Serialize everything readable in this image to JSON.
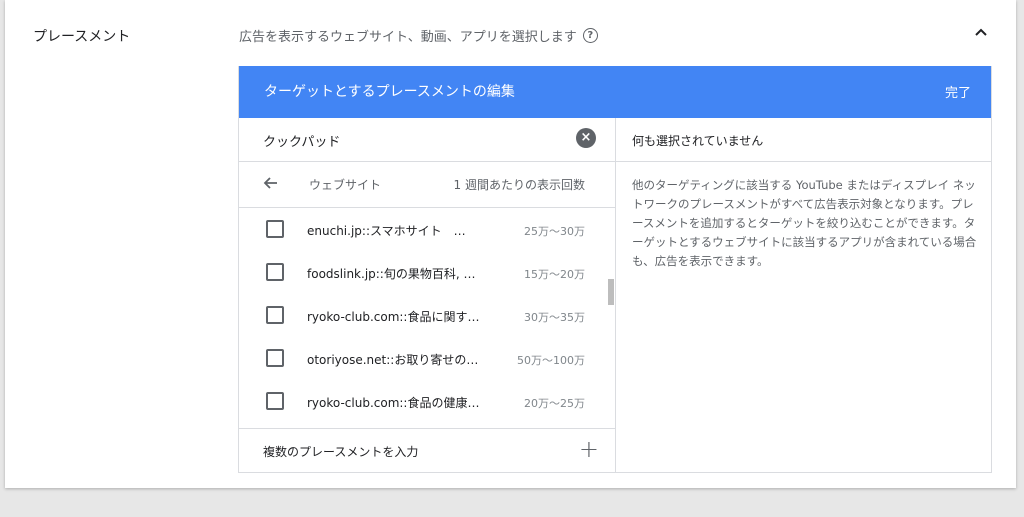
{
  "section": {
    "label": "プレースメント",
    "description": "広告を表示するウェブサイト、動画、アプリを選択します"
  },
  "editor": {
    "title": "ターゲットとするプレースメントの編集",
    "done_label": "完了",
    "search_value": "クックパッド",
    "nav": {
      "category": "ウェブサイト",
      "column_header": "1 週間あたりの表示回数"
    },
    "items": [
      {
        "name": "enuchi.jp::スマホサイト　…",
        "count": "25万～30万"
      },
      {
        "name": "foodslink.jp::旬の果物百科, …",
        "count": "15万～20万"
      },
      {
        "name": "ryoko-club.com::食品に関す…",
        "count": "30万～35万"
      },
      {
        "name": "otoriyose.net::お取り寄せの…",
        "count": "50万～100万"
      },
      {
        "name": "ryoko-club.com::食品の健康…",
        "count": "20万～25万"
      }
    ],
    "multi_input_label": "複数のプレースメントを入力",
    "selected": {
      "title": "何も選択されていません",
      "description": "他のターゲティングに該当する YouTube またはディスプレイ ネットワークのプレースメントがすべて広告表示対象となります。プレースメントを追加するとターゲットを絞り込むことができます。ターゲットとするウェブサイトに該当するアプリが含まれている場合も、広告を表示できます。"
    }
  },
  "colors": {
    "header_bg": "#4285f4",
    "text": "#202124",
    "muted": "#5f6368"
  }
}
